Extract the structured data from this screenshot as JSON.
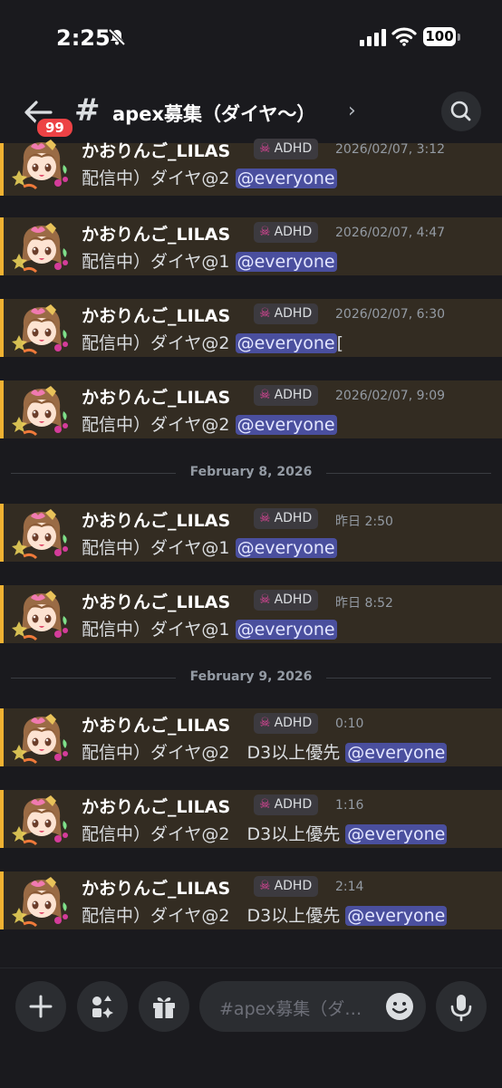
{
  "status_bar": {
    "time": "2:25",
    "battery": "100"
  },
  "header": {
    "back_badge": "99",
    "channel_name": "apex募集（ダイヤ〜）",
    "chevron": "›"
  },
  "messages": [
    {
      "username": "かおりんご_LILAS",
      "role_tag": "ADHD",
      "timestamp": "2026/02/07, 3:12",
      "text": "配信中）ダイヤ@2 ",
      "mention": "@everyone",
      "suffix": ""
    },
    {
      "username": "かおりんご_LILAS",
      "role_tag": "ADHD",
      "timestamp": "2026/02/07, 4:47",
      "text": "配信中）ダイヤ@1 ",
      "mention": "@everyone",
      "suffix": ""
    },
    {
      "username": "かおりんご_LILAS",
      "role_tag": "ADHD",
      "timestamp": "2026/02/07, 6:30",
      "text": "配信中）ダイヤ@2 ",
      "mention": "@everyone",
      "suffix": "["
    },
    {
      "username": "かおりんご_LILAS",
      "role_tag": "ADHD",
      "timestamp": "2026/02/07, 9:09",
      "text": "配信中）ダイヤ@2 ",
      "mention": "@everyone",
      "suffix": ""
    },
    {
      "username": "かおりんご_LILAS",
      "role_tag": "ADHD",
      "timestamp": "昨日 2:50",
      "text": "配信中）ダイヤ@1 ",
      "mention": "@everyone",
      "suffix": ""
    },
    {
      "username": "かおりんご_LILAS",
      "role_tag": "ADHD",
      "timestamp": "昨日 8:52",
      "text": "配信中）ダイヤ@1 ",
      "mention": "@everyone",
      "suffix": ""
    },
    {
      "username": "かおりんご_LILAS",
      "role_tag": "ADHD",
      "timestamp": "0:10",
      "text": "配信中）ダイヤ@2　D3以上優先 ",
      "mention": "@everyone",
      "suffix": ""
    },
    {
      "username": "かおりんご_LILAS",
      "role_tag": "ADHD",
      "timestamp": "1:16",
      "text": "配信中）ダイヤ@2　D3以上優先 ",
      "mention": "@everyone",
      "suffix": ""
    },
    {
      "username": "かおりんご_LILAS",
      "role_tag": "ADHD",
      "timestamp": "2:14",
      "text": "配信中）ダイヤ@2　D3以上優先 ",
      "mention": "@everyone",
      "suffix": ""
    }
  ],
  "dividers": [
    "February 8, 2026",
    "February 9, 2026"
  ],
  "composer": {
    "placeholder": "#apex募集（ダ…"
  },
  "colors": {
    "highlight_bg": "#332c22",
    "highlight_bar": "#f0b232",
    "mention_bg": "#4a4f9e",
    "badge_red": "#ed4245"
  },
  "icons": {
    "status": [
      "bell-slash-icon",
      "signal-icon",
      "wifi-icon"
    ],
    "header": [
      "back-arrow-icon",
      "search-icon"
    ],
    "composer": [
      "plus-icon",
      "apps-icon",
      "gift-icon",
      "emoji-icon",
      "microphone-icon"
    ]
  }
}
